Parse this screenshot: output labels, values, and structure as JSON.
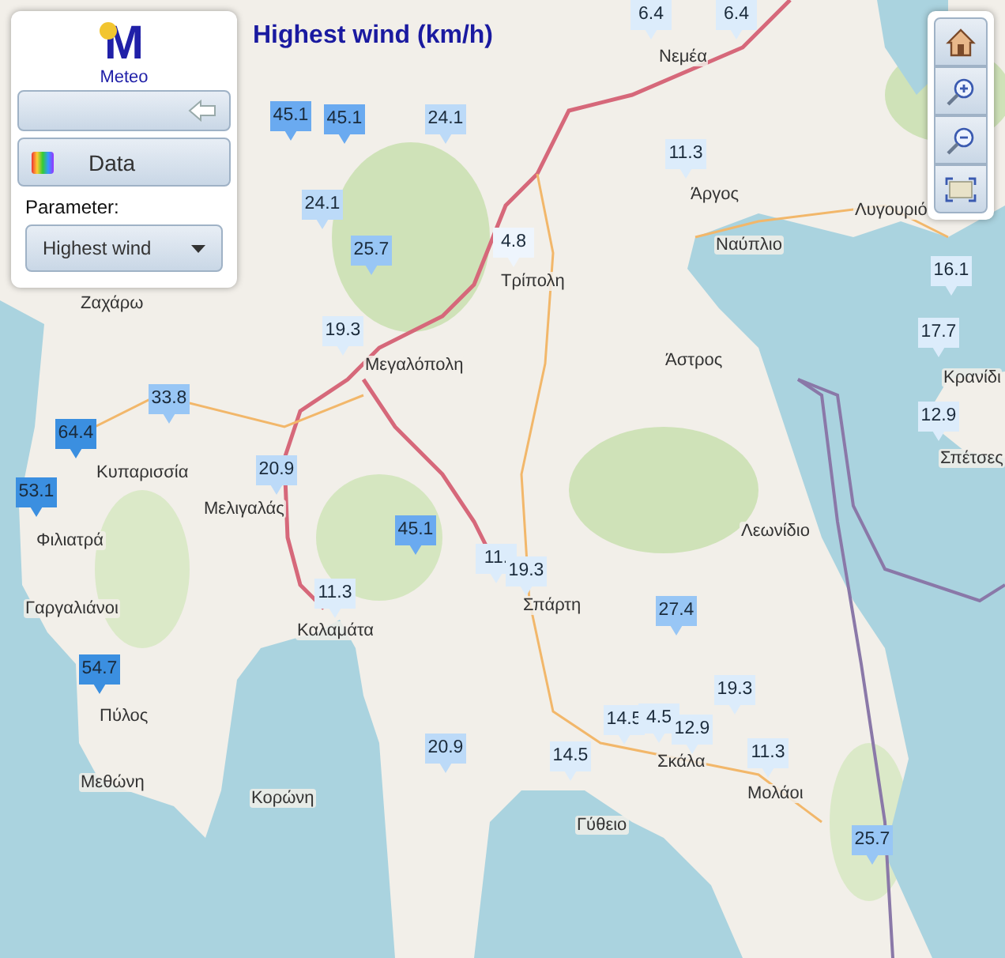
{
  "title": "Highest wind (km/h)",
  "panel": {
    "logo_mark": "M",
    "logo_text": "Meteo",
    "data_button": "Data",
    "parameter_label": "Parameter:",
    "parameter_select": "Highest wind"
  },
  "map_controls": [
    {
      "kind": "home"
    },
    {
      "kind": "zoom_in"
    },
    {
      "kind": "zoom_out"
    },
    {
      "kind": "extent"
    }
  ],
  "places": [
    "Νεμέα",
    "Άργος",
    "Λυγουριό",
    "Ναύπλιο",
    "Τρίπολη",
    "Άστρος",
    "Κρανίδι",
    "Σπέτσες",
    "Μεγαλόπολη",
    "Ζαχάρω",
    "Κυπαρισσία",
    "Μελιγαλάς",
    "Φιλιατρά",
    "Γαργαλιάνοι",
    "Καλαμάτα",
    "Σπάρτη",
    "Λεωνίδιο",
    "Πύλος",
    "Μεθώνη",
    "Κορώνη",
    "Σκάλα",
    "Μολάοι",
    "Γύθειο"
  ],
  "stations": [
    {
      "value": "6.4",
      "color": "#dcecfb"
    },
    {
      "value": "6.4",
      "color": "#dcecfb"
    },
    {
      "value": "45.1",
      "color": "#6aaaf0"
    },
    {
      "value": "45.1",
      "color": "#6aaaf0"
    },
    {
      "value": "24.1",
      "color": "#bcdaf8"
    },
    {
      "value": "11.3",
      "color": "#dcecfb"
    },
    {
      "value": "24.1",
      "color": "#bcdaf8"
    },
    {
      "value": "4.8",
      "color": "#eef5fd"
    },
    {
      "value": "25.7",
      "color": "#98c6f5"
    },
    {
      "value": "16.1",
      "color": "#dcecfb"
    },
    {
      "value": "19.3",
      "color": "#dcecfb"
    },
    {
      "value": "17.7",
      "color": "#dcecfb"
    },
    {
      "value": "33.8",
      "color": "#98c6f5"
    },
    {
      "value": "12.9",
      "color": "#dcecfb"
    },
    {
      "value": "64.4",
      "color": "#3b8fe0"
    },
    {
      "value": "20.9",
      "color": "#bcdaf8"
    },
    {
      "value": "53.1",
      "color": "#3b8fe0"
    },
    {
      "value": "45.1",
      "color": "#6aaaf0"
    },
    {
      "value": "11.",
      "color": "#dcecfb"
    },
    {
      "value": "19.3",
      "color": "#dcecfb"
    },
    {
      "value": "11.3",
      "color": "#dcecfb"
    },
    {
      "value": "27.4",
      "color": "#98c6f5"
    },
    {
      "value": "54.7",
      "color": "#3b8fe0"
    },
    {
      "value": "19.3",
      "color": "#dcecfb"
    },
    {
      "value": "14.5",
      "color": "#dcecfb"
    },
    {
      "value": "4.5",
      "color": "#dcecfb"
    },
    {
      "value": "12.9",
      "color": "#dcecfb"
    },
    {
      "value": "20.9",
      "color": "#bcdaf8"
    },
    {
      "value": "14.5",
      "color": "#dcecfb"
    },
    {
      "value": "11.3",
      "color": "#dcecfb"
    },
    {
      "value": "25.7",
      "color": "#98c6f5"
    }
  ]
}
